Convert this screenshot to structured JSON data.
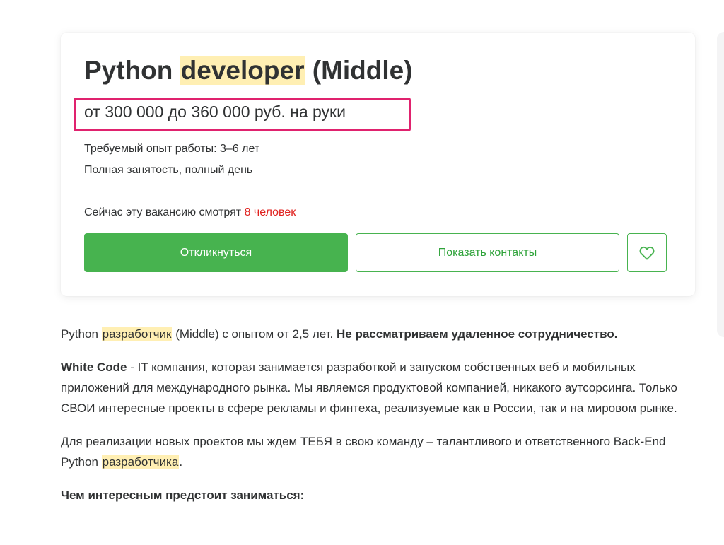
{
  "vacancy": {
    "title_prefix": "Python ",
    "title_highlight": "developer",
    "title_suffix": " (Middle)",
    "salary": "от 300 000 до 360 000 руб. на руки",
    "experience": "Требуемый опыт работы: 3–6 лет",
    "employment": "Полная занятость, полный день",
    "viewers_prefix": "Сейчас эту вакансию смотрят ",
    "viewers_count": "8 человек"
  },
  "actions": {
    "apply_label": "Откликнуться",
    "contacts_label": "Показать контакты",
    "favorite_icon": "heart-icon"
  },
  "description": {
    "p1_prefix": "Python ",
    "p1_highlight": "разработчик",
    "p1_middle": " (Middle) с опытом от 2,5 лет. ",
    "p1_bold": "Не рассматриваем удаленное сотрудничество.",
    "p2_bold": "White Code",
    "p2_text": " - IT компания, которая занимается разработкой и запуском собственных веб и мобильных приложений для международного рынка. Мы являемся продуктовой компанией, никакого аутсорсинга. Только СВОИ интересные проекты в сфере рекламы и финтеха, реализуемые как в России, так и на мировом рынке.",
    "p3_text": "Для реализации новых проектов мы ждем ТЕБЯ в свою команду – талантливого и ответственного Back-End Python ",
    "p3_highlight": "разработчика",
    "p3_suffix": ".",
    "p4_bold": "Чем интересным предстоит заниматься:"
  },
  "colors": {
    "highlight": "#ffefb3",
    "salary_frame": "#e0226e",
    "accent_green": "#47b34f",
    "viewers_red": "#e0221f"
  }
}
